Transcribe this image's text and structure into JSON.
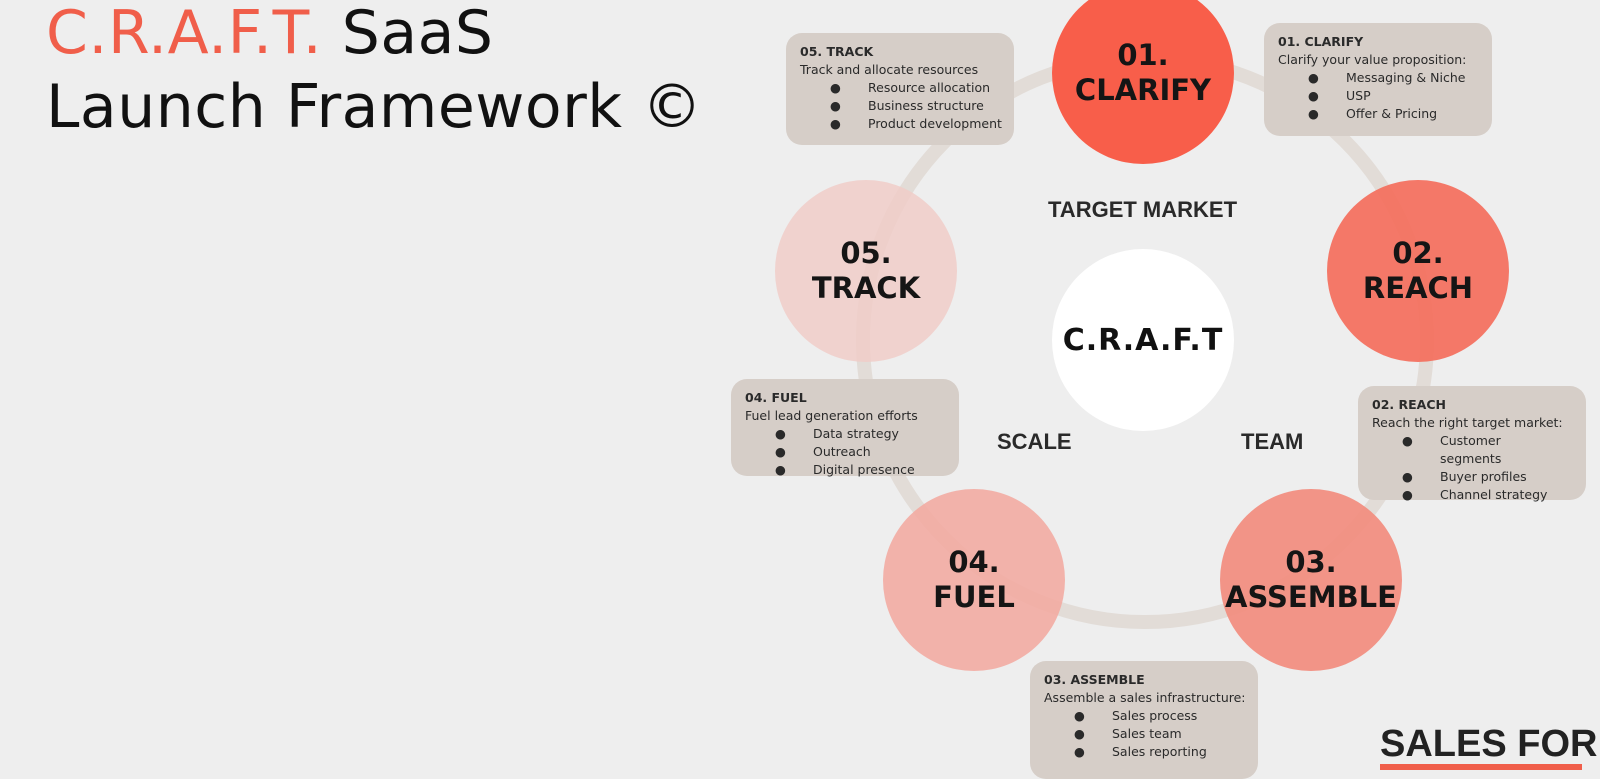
{
  "title": {
    "accent": "C.R.A.F.T.",
    "rest_line1": " SaaS",
    "line2": "Launch Framework ©"
  },
  "colors": {
    "accent": "#f05e4a",
    "background": "#eeeeee",
    "box": "#d6cec8",
    "ring": "#e2dcd7"
  },
  "center": {
    "label": "C.R.A.F.T"
  },
  "axis_labels": {
    "top": "TARGET MARKET",
    "left": "SCALE",
    "right": "TEAM"
  },
  "steps": [
    {
      "num": "01.",
      "name": "CLARIFY",
      "color": "#f85e4a",
      "box_title": "01. CLARIFY",
      "box_subtitle": "Clarify your value proposition:",
      "items": [
        "Messaging & Niche",
        "USP",
        "Offer & Pricing"
      ]
    },
    {
      "num": "02.",
      "name": "REACH",
      "color": "#f47a69",
      "box_title": "02. REACH",
      "box_subtitle": "Reach the right target market:",
      "items": [
        "Customer segments",
        "Buyer profiles",
        "Channel strategy"
      ]
    },
    {
      "num": "03.",
      "name": "ASSEMBLE",
      "color": "#f2958a",
      "box_title": "03. ASSEMBLE",
      "box_subtitle": "Assemble a sales infrastructure:",
      "items": [
        "Sales process",
        "Sales team",
        "Sales reporting"
      ]
    },
    {
      "num": "04.",
      "name": "FUEL",
      "color": "#f2b4ab",
      "box_title": "04. FUEL",
      "box_subtitle": "Fuel lead generation efforts",
      "items": [
        "Data strategy",
        "Outreach",
        "Digital presence"
      ]
    },
    {
      "num": "05.",
      "name": "TRACK",
      "color": "#f0d3cf",
      "box_title": "05. TRACK",
      "box_subtitle": "Track and allocate resources",
      "items": [
        "Resource allocation",
        "Business structure",
        "Product development"
      ]
    }
  ],
  "bullet": "●",
  "logo": {
    "line1": "SALES FOR"
  }
}
